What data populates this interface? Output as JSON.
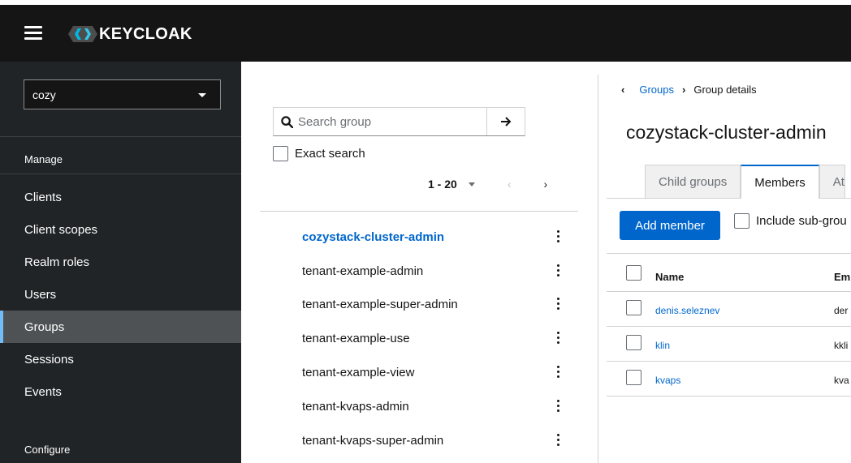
{
  "header": {
    "brand": "KEYCLOAK"
  },
  "sidebar": {
    "realm": "cozy",
    "section_manage": "Manage",
    "items": [
      {
        "label": "Clients"
      },
      {
        "label": "Client scopes"
      },
      {
        "label": "Realm roles"
      },
      {
        "label": "Users"
      },
      {
        "label": "Groups",
        "active": true
      },
      {
        "label": "Sessions"
      },
      {
        "label": "Events"
      }
    ],
    "section_configure": "Configure"
  },
  "groups_panel": {
    "search_placeholder": "Search group",
    "exact_search_label": "Exact search",
    "pagination": "1 - 20",
    "groups": [
      {
        "name": "cozystack-cluster-admin",
        "active": true
      },
      {
        "name": "tenant-example-admin"
      },
      {
        "name": "tenant-example-super-admin"
      },
      {
        "name": "tenant-example-use"
      },
      {
        "name": "tenant-example-view"
      },
      {
        "name": "tenant-kvaps-admin"
      },
      {
        "name": "tenant-kvaps-super-admin"
      }
    ]
  },
  "detail": {
    "breadcrumb": {
      "parent": "Groups",
      "current": "Group details"
    },
    "title": "cozystack-cluster-admin",
    "tabs": [
      {
        "label": "Child groups"
      },
      {
        "label": "Members",
        "active": true
      },
      {
        "label": "At"
      }
    ],
    "add_member_label": "Add member",
    "include_subgroups_label": "Include sub-grou",
    "columns": {
      "name": "Name",
      "email": "Em"
    },
    "members": [
      {
        "name": "denis.seleznev",
        "email": "der"
      },
      {
        "name": "klin",
        "email": "kkli"
      },
      {
        "name": "kvaps",
        "email": "kva"
      }
    ]
  }
}
